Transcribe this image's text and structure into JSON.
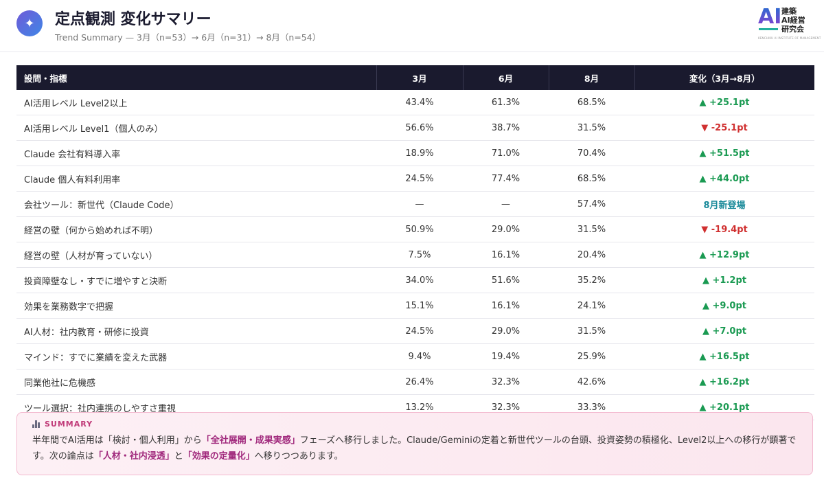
{
  "header": {
    "icon": "sparkle-icon",
    "title": "定点観測 変化サマリー",
    "subtitle": "Trend Summary — 3月（n=53）→ 6月（n=31）→ 8月（n=54）"
  },
  "brand": {
    "ai": "AI",
    "line1": "建築",
    "line2": "AI経営",
    "line3": "研究会",
    "tagline": "KENCHIKU AI INSTITUTE OF MANAGEMENT"
  },
  "table": {
    "columns": [
      "設問・指標",
      "3月",
      "6月",
      "8月",
      "変化（3月→8月）"
    ],
    "rows": [
      {
        "label": "AI活用レベル Level2以上",
        "mar": "43.4%",
        "jun": "61.3%",
        "aug": "68.5%",
        "change": "▲ +25.1pt",
        "trend": "up"
      },
      {
        "label": "AI活用レベル Level1（個人のみ）",
        "mar": "56.6%",
        "jun": "38.7%",
        "aug": "31.5%",
        "change": "▼ -25.1pt",
        "trend": "down"
      },
      {
        "label": "Claude 会社有料導入率",
        "mar": "18.9%",
        "jun": "71.0%",
        "aug": "70.4%",
        "change": "▲ +51.5pt",
        "trend": "up"
      },
      {
        "label": "Claude 個人有料利用率",
        "mar": "24.5%",
        "jun": "77.4%",
        "aug": "68.5%",
        "change": "▲ +44.0pt",
        "trend": "up"
      },
      {
        "label": "会社ツール：新世代（Claude Code）",
        "mar": "—",
        "jun": "—",
        "aug": "57.4%",
        "change": "8月新登場",
        "trend": "new"
      },
      {
        "label": "経営の壁（何から始めれば不明）",
        "mar": "50.9%",
        "jun": "29.0%",
        "aug": "31.5%",
        "change": "▼ -19.4pt",
        "trend": "down"
      },
      {
        "label": "経営の壁（人材が育っていない）",
        "mar": "7.5%",
        "jun": "16.1%",
        "aug": "20.4%",
        "change": "▲ +12.9pt",
        "trend": "up"
      },
      {
        "label": "投資障壁なし・すでに増やすと決断",
        "mar": "34.0%",
        "jun": "51.6%",
        "aug": "35.2%",
        "change": "▲ +1.2pt",
        "trend": "up"
      },
      {
        "label": "効果を業務数字で把握",
        "mar": "15.1%",
        "jun": "16.1%",
        "aug": "24.1%",
        "change": "▲ +9.0pt",
        "trend": "up"
      },
      {
        "label": "AI人材：社内教育・研修に投資",
        "mar": "24.5%",
        "jun": "29.0%",
        "aug": "31.5%",
        "change": "▲ +7.0pt",
        "trend": "up"
      },
      {
        "label": "マインド：すでに業績を変えた武器",
        "mar": "9.4%",
        "jun": "19.4%",
        "aug": "25.9%",
        "change": "▲ +16.5pt",
        "trend": "up"
      },
      {
        "label": "同業他社に危機感",
        "mar": "26.4%",
        "jun": "32.3%",
        "aug": "42.6%",
        "change": "▲ +16.2pt",
        "trend": "up"
      },
      {
        "label": "ツール選択：社内連携のしやすさ重視",
        "mar": "13.2%",
        "jun": "32.3%",
        "aug": "33.3%",
        "change": "▲ +20.1pt",
        "trend": "up"
      }
    ]
  },
  "summary": {
    "icon": "bar-chart-icon",
    "heading": "SUMMARY",
    "t1": "半年間でAI活用は「検討・個人利用」から",
    "h1": "「全社展開・成果実感」",
    "t2": "フェーズへ移行しました。Claude/Geminiの定着と新世代ツールの台頭、投資姿勢の積極化、Level2以上への移行が顕著です。次の論点は",
    "h2": "「人材・社内浸透」",
    "t3": "と",
    "h3": "「効果の定量化」",
    "t4": "へ移りつつあります。"
  },
  "colors": {
    "up": "#1a9a52",
    "down": "#d03030",
    "new": "#1a8a9a",
    "header_bg": "#1a1a2e",
    "accent": "#a0287c"
  }
}
